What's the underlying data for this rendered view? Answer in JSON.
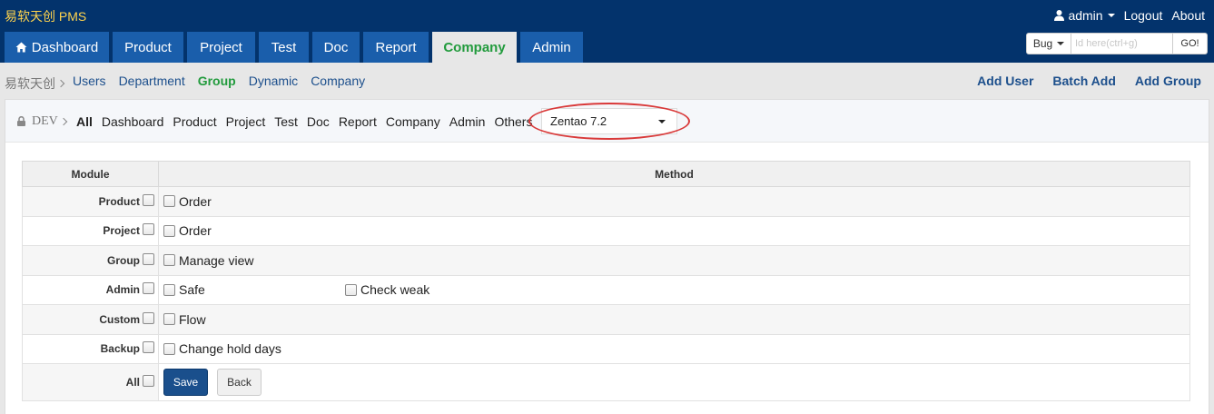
{
  "app": {
    "title": "易软天创 PMS"
  },
  "topnav": {
    "user": "admin",
    "logout": "Logout",
    "about": "About"
  },
  "mainnav": [
    {
      "label": "Dashboard",
      "icon": "home-icon",
      "active": false
    },
    {
      "label": "Product",
      "active": false
    },
    {
      "label": "Project",
      "active": false
    },
    {
      "label": "Test",
      "active": false
    },
    {
      "label": "Doc",
      "active": false
    },
    {
      "label": "Report",
      "active": false
    },
    {
      "label": "Company",
      "active": true
    },
    {
      "label": "Admin",
      "active": false
    }
  ],
  "search": {
    "type": "Bug",
    "placeholder": "Id here(ctrl+g)",
    "go": "GO!"
  },
  "subnav": {
    "crumb": "易软天创",
    "links": [
      {
        "label": "Users",
        "active": false
      },
      {
        "label": "Department",
        "active": false
      },
      {
        "label": "Group",
        "active": true
      },
      {
        "label": "Dynamic",
        "active": false
      },
      {
        "label": "Company",
        "active": false
      }
    ],
    "actions": [
      "Add User",
      "Batch Add",
      "Add Group"
    ]
  },
  "filterbar": {
    "group": "DEV",
    "filters": [
      {
        "label": "All",
        "active": true
      },
      {
        "label": "Dashboard",
        "active": false
      },
      {
        "label": "Product",
        "active": false
      },
      {
        "label": "Project",
        "active": false
      },
      {
        "label": "Test",
        "active": false
      },
      {
        "label": "Doc",
        "active": false
      },
      {
        "label": "Report",
        "active": false
      },
      {
        "label": "Company",
        "active": false
      },
      {
        "label": "Admin",
        "active": false
      },
      {
        "label": "Others",
        "active": false
      }
    ],
    "version": "Zentao 7.2"
  },
  "table": {
    "headers": {
      "module": "Module",
      "method": "Method"
    },
    "rows": [
      {
        "module": "Product",
        "methods": [
          "Order"
        ]
      },
      {
        "module": "Project",
        "methods": [
          "Order"
        ]
      },
      {
        "module": "Group",
        "methods": [
          "Manage view"
        ]
      },
      {
        "module": "Admin",
        "methods": [
          "Safe",
          "Check weak"
        ]
      },
      {
        "module": "Custom",
        "methods": [
          "Flow"
        ]
      },
      {
        "module": "Backup",
        "methods": [
          "Change hold days"
        ]
      }
    ],
    "footer": {
      "all": "All",
      "save": "Save",
      "back": "Back"
    }
  },
  "colors": {
    "header": "#03336c",
    "tab": "#1a5eab",
    "active": "#229b3d",
    "link": "#1c4f8c",
    "highlight": "#d93a3a"
  }
}
